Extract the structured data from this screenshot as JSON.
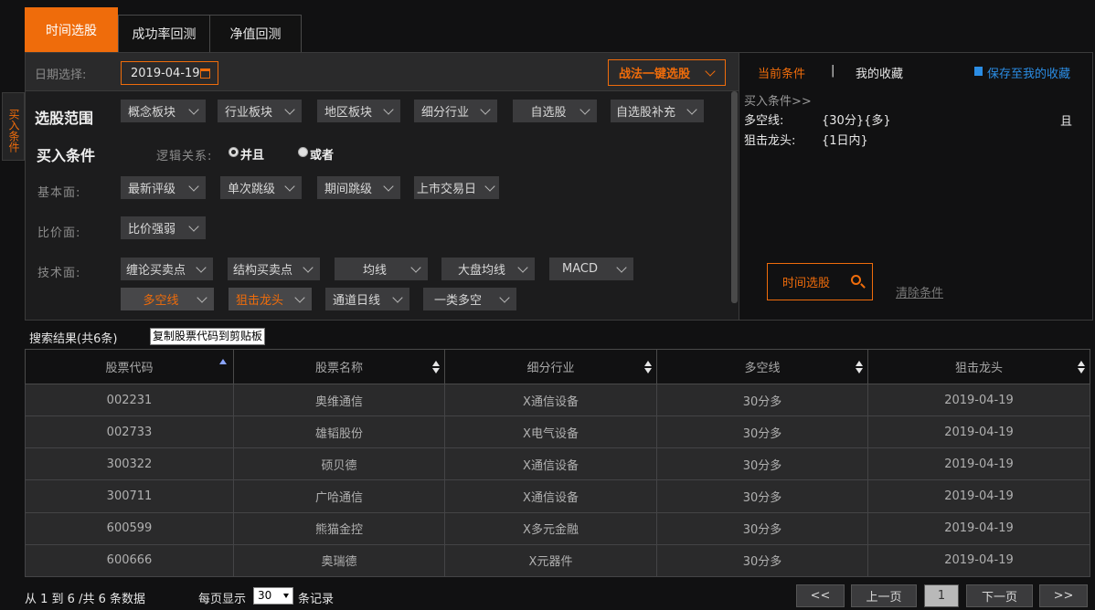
{
  "tabs": [
    {
      "label": "时间选股",
      "active": true
    },
    {
      "label": "成功率回测",
      "active": false
    },
    {
      "label": "净值回测",
      "active": false
    }
  ],
  "date_bar": {
    "label": "日期选择:",
    "date_value": "2019-04-19",
    "strategy_button": "战法一键选股"
  },
  "side_tab": {
    "label": "买入条件"
  },
  "scope": {
    "title": "选股范围",
    "dropdowns": [
      "概念板块",
      "行业板块",
      "地区板块",
      "细分行业",
      "自选股",
      "自选股补充"
    ]
  },
  "buy_conditions": {
    "title": "买入条件",
    "logic_label": "逻辑关系:",
    "logic_and": "并且",
    "logic_or": "或者"
  },
  "fundamental": {
    "label": "基本面:",
    "dropdowns": [
      "最新评级",
      "单次跳级",
      "期间跳级",
      "上市交易日"
    ]
  },
  "price_compare": {
    "label": "比价面:",
    "dropdowns": [
      "比价强弱"
    ]
  },
  "technical": {
    "label": "技术面:",
    "row1": [
      "缠论买卖点",
      "结构买卖点",
      "均线",
      "大盘均线",
      "MACD"
    ],
    "row2": [
      "多空线",
      "狙击龙头",
      "通道日线",
      "一类多空"
    ]
  },
  "right_panel": {
    "current_tab": "当前条件",
    "separator": "|",
    "favorites_tab": "我的收藏",
    "save_link": "保存至我的收藏",
    "buy_header": "买入条件>>",
    "conditions": [
      {
        "name": "多空线:",
        "value": "{30分}{多}"
      },
      {
        "name": "狙击龙头:",
        "value": "{1日内}"
      }
    ],
    "and_label": "且",
    "search_button": "时间选股",
    "clear_button": "清除条件"
  },
  "results": {
    "summary": "搜索结果(共6条)",
    "copy_button": "复制股票代码到剪贴板",
    "columns": [
      "股票代码",
      "股票名称",
      "细分行业",
      "多空线",
      "狙击龙头"
    ],
    "rows": [
      [
        "002231",
        "奥维通信",
        "X通信设备",
        "30分多",
        "2019-04-19"
      ],
      [
        "002733",
        "雄韬股份",
        "X电气设备",
        "30分多",
        "2019-04-19"
      ],
      [
        "300322",
        "硕贝德",
        "X通信设备",
        "30分多",
        "2019-04-19"
      ],
      [
        "300711",
        "广哈通信",
        "X通信设备",
        "30分多",
        "2019-04-19"
      ],
      [
        "600599",
        "熊猫金控",
        "X多元金融",
        "30分多",
        "2019-04-19"
      ],
      [
        "600666",
        "奥瑞德",
        "X元器件",
        "30分多",
        "2019-04-19"
      ]
    ]
  },
  "footer": {
    "range_text": "从 1 到 6 /共 6 条数据",
    "per_page_label": "每页显示",
    "per_page_value": "30",
    "records_label": "条记录",
    "first": "<<",
    "prev": "上一页",
    "current_page": "1",
    "next": "下一页",
    "last": ">>"
  },
  "colors": {
    "accent": "#ef6c0b",
    "link": "#2b8de4",
    "background": "#111112"
  }
}
